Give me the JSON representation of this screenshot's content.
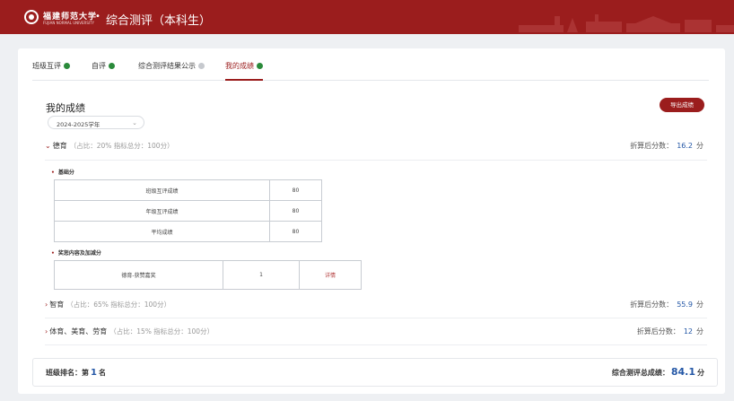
{
  "header": {
    "logo_text": "福建师范大学",
    "logo_sub": "FUJIAN NORMAL UNIVERSITY",
    "separator": "•",
    "title": "综合测评（本科生）"
  },
  "tabs": [
    {
      "label": "班级互评",
      "status": "done"
    },
    {
      "label": "自评",
      "status": "done"
    },
    {
      "label": "综合测评结果公示",
      "status": "pending"
    },
    {
      "label": "我的成绩",
      "status": "done"
    }
  ],
  "main": {
    "section_title": "我的成绩",
    "year_select": "2024-2025学年",
    "export_label": "导出成绩"
  },
  "categories": [
    {
      "arrow": "⌄",
      "name": "德育",
      "note": "（占比：20% 指标总分：100分）",
      "score_label": "折算后分数：",
      "score": "16.2",
      "unit": "分"
    },
    {
      "arrow": "›",
      "name": "智育",
      "note": "（占比：65% 指标总分：100分）",
      "score_label": "折算后分数：",
      "score": "55.9",
      "unit": "分"
    },
    {
      "arrow": "›",
      "name": "体育、美育、劳育",
      "note": "（占比：15% 指标总分：100分）",
      "score_label": "折算后分数：",
      "score": "12",
      "unit": "分"
    }
  ],
  "moral": {
    "base_label": "基础分",
    "base_rows": [
      {
        "item": "班级互评成绩",
        "value": "80"
      },
      {
        "item": "年级互评成绩",
        "value": "80"
      },
      {
        "item": "平均成绩",
        "value": "80"
      }
    ],
    "bonus_label": "奖惩内容及加减分",
    "bonus_rows": [
      {
        "item": "德育-获赞嘉奖",
        "value": "1",
        "action": "详情"
      }
    ]
  },
  "summary": {
    "rank_prefix": "班级排名：第",
    "rank": "1",
    "rank_suffix": "名",
    "total_label": "综合测评总成绩：",
    "total": "84.1",
    "total_unit": "分"
  },
  "colors": {
    "brand": "#9b1d1d",
    "accent": "#2457a6",
    "done": "#2a8a3a"
  }
}
